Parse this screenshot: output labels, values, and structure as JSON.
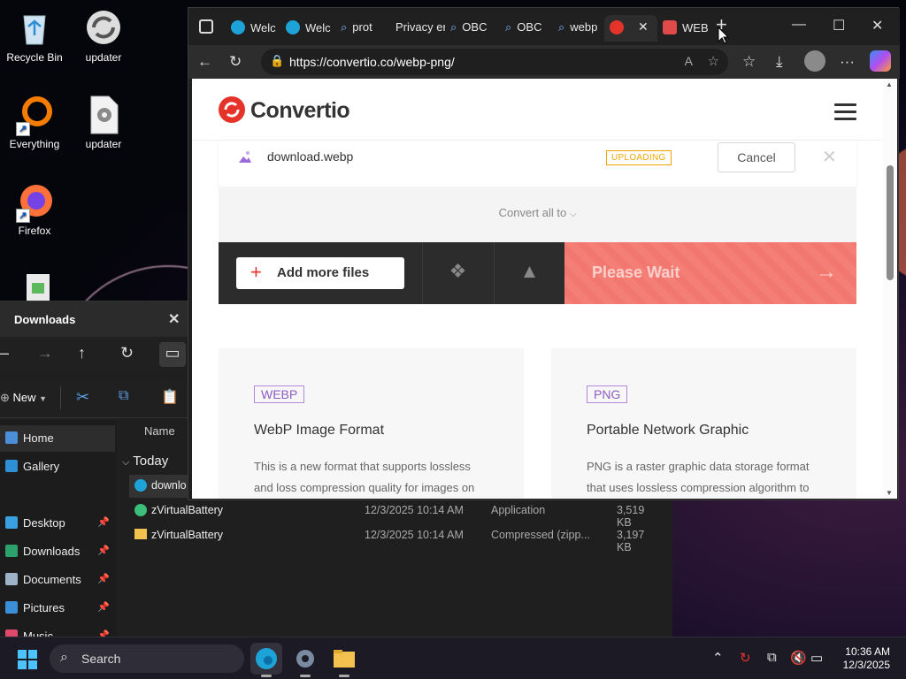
{
  "desktop": {
    "icons": [
      {
        "label": "Recycle Bin",
        "icon": "recycle-bin-icon"
      },
      {
        "label": "updater",
        "icon": "updater-sync-icon"
      },
      {
        "label": "Everything",
        "icon": "everything-search-icon"
      },
      {
        "label": "updater",
        "icon": "updater-file-icon"
      },
      {
        "label": "Firefox",
        "icon": "firefox-icon"
      }
    ]
  },
  "browser": {
    "tabs": [
      {
        "label": "Welc",
        "icon": "edge-icon"
      },
      {
        "label": "Welc",
        "icon": "edge-icon"
      },
      {
        "label": "prot",
        "icon": "search-icon"
      },
      {
        "label": "Privacy er",
        "icon": "none"
      },
      {
        "label": "OBC",
        "icon": "search-icon"
      },
      {
        "label": "OBC",
        "icon": "search-icon"
      },
      {
        "label": "webp",
        "icon": "search-icon"
      },
      {
        "label": "",
        "icon": "convertio-icon"
      },
      {
        "label": "WEB",
        "icon": "cloud-icon"
      }
    ],
    "url": "https://convertio.co/webp-png/",
    "colors": {
      "accent": "#e5332a",
      "tab_bg": "#202020"
    }
  },
  "convertio": {
    "logo_text": "Convertio",
    "file": {
      "name": "download.webp",
      "status": "UPLOADING",
      "cancel_label": "Cancel"
    },
    "convert_all_label": "Convert all to",
    "add_files_label": "Add more files",
    "wait_label": "Please Wait",
    "cards": [
      {
        "tag": "WEBP",
        "title": "WebP Image Format",
        "desc": "This is a new format that supports lossless and loss compression quality for images on"
      },
      {
        "tag": "PNG",
        "title": "Portable Network Graphic",
        "desc": "PNG is a raster graphic data storage format that uses lossless compression algorithm to"
      }
    ]
  },
  "explorer": {
    "title": "Downloads",
    "new_label": "New",
    "sidebar": [
      {
        "label": "Home",
        "icon": "home-icon",
        "pinned": false
      },
      {
        "label": "Gallery",
        "icon": "gallery-icon",
        "pinned": false
      },
      {
        "label": "Desktop",
        "icon": "desktop-icon",
        "pinned": true
      },
      {
        "label": "Downloads",
        "icon": "download-icon",
        "pinned": true
      },
      {
        "label": "Documents",
        "icon": "documents-icon",
        "pinned": true
      },
      {
        "label": "Pictures",
        "icon": "pictures-icon",
        "pinned": true
      },
      {
        "label": "Music",
        "icon": "music-icon",
        "pinned": true
      }
    ],
    "column_name": "Name",
    "group": "Today",
    "files": [
      {
        "name": "downlo",
        "date": "",
        "type": "",
        "size": ""
      },
      {
        "name": "zVirtualBattery",
        "date": "12/3/2025 10:14 AM",
        "type": "Application",
        "size": "3,519 KB"
      },
      {
        "name": "zVirtualBattery",
        "date": "12/3/2025 10:14 AM",
        "type": "Compressed (zipp...",
        "size": "3,197 KB"
      }
    ]
  },
  "taskbar": {
    "search_label": "Search",
    "time": "10:36 AM",
    "date": "12/3/2025"
  }
}
